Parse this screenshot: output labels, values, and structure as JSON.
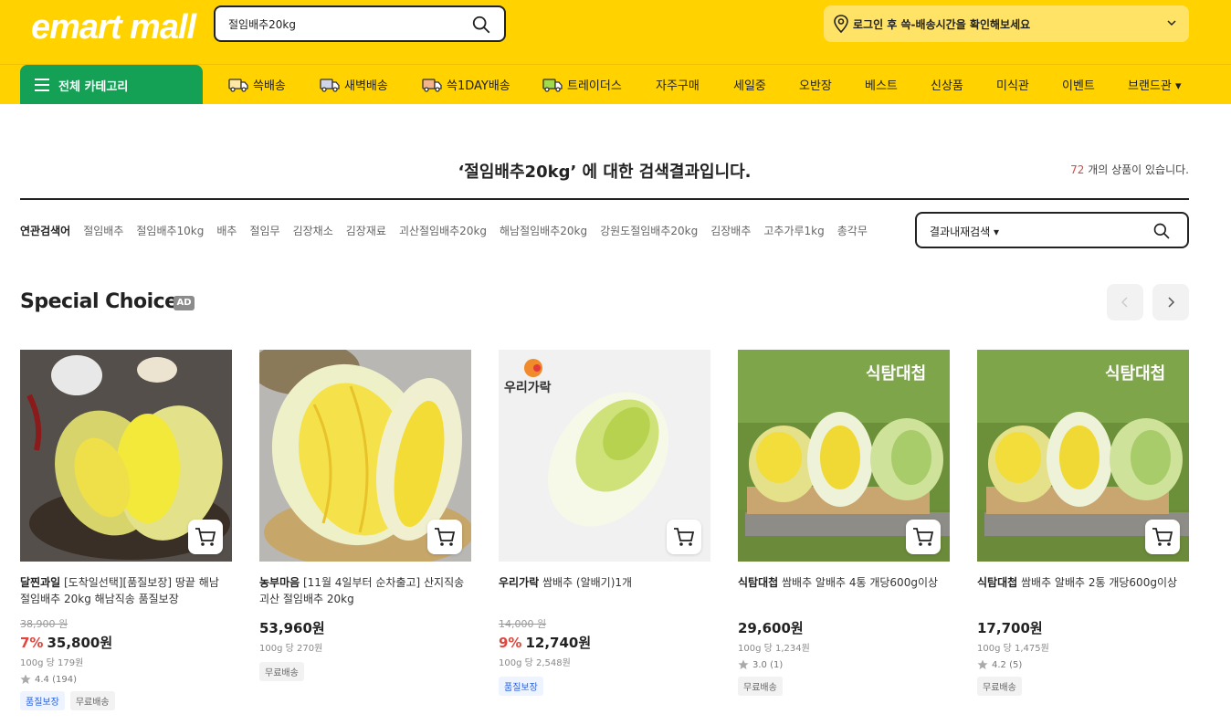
{
  "header": {
    "logo": "emart mall",
    "search_value": "절임배추20kg",
    "delivery_text": "로그인 후 쓱-배송시간을 확인해보세요",
    "all_category": "전체 카테고리",
    "nav": [
      {
        "label": "쓱배송",
        "icon": "truck-icon",
        "color": "#ffe7a6"
      },
      {
        "label": "새벽배송",
        "icon": "truck-icon",
        "color": "#cfd6ea"
      },
      {
        "label": "쓱1DAY배송",
        "icon": "truck-icon",
        "color": "#f2b48a"
      },
      {
        "label": "트레이더스",
        "icon": "truck-icon",
        "color": "#a3d94c"
      },
      {
        "label": "자주구매"
      },
      {
        "label": "세일중"
      },
      {
        "label": "오반장"
      },
      {
        "label": "베스트"
      },
      {
        "label": "신상품"
      },
      {
        "label": "미식관"
      },
      {
        "label": "이벤트"
      },
      {
        "label": "브랜드관 ▾"
      }
    ]
  },
  "result": {
    "title": "‘절임배추20kg’ 에 대한 검색결과입니다.",
    "count": "72",
    "count_suffix": " 개의 상품이 있습니다."
  },
  "related": {
    "head": "연관검색어",
    "keywords": [
      "절임배추",
      "절임배추10kg",
      "배추",
      "절임무",
      "김장채소",
      "김장재료",
      "괴산절임배추20kg",
      "해남절임배추20kg",
      "강원도절임배추20kg",
      "김장배추",
      "고추가루1kg",
      "총각무"
    ]
  },
  "inner_search": {
    "label": "결과내재검색 ▾"
  },
  "special": {
    "title": "Special Choice",
    "ad": "AD"
  },
  "products": [
    {
      "brand": "달찐과일",
      "name": " [도착일선택][품질보장] 땅끝 해남 절임배추 20kg 해남직송 품질보장",
      "orig": "38,900 원",
      "disc": "7%",
      "price": "35,800원",
      "unit": "100g 당 179원",
      "rating": "4.4 (194)",
      "tags": [
        {
          "t": "품질보장",
          "blue": true
        },
        {
          "t": "무료배송",
          "blue": false
        }
      ]
    },
    {
      "brand": "농부마음",
      "name": " [11월 4일부터 순차출고] 산지직송 괴산 절임배추 20kg",
      "orig": "",
      "disc": "",
      "price": "53,960원",
      "unit": "100g 당 270원",
      "rating": "",
      "tags": [
        {
          "t": "무료배송",
          "blue": false
        }
      ]
    },
    {
      "brand": "우리가락",
      "name": " 쌈배추 (알배기)1개",
      "orig": "14,000 원",
      "disc": "9%",
      "price": "12,740원",
      "unit": "100g 당 2,548원",
      "rating": "",
      "tags": [
        {
          "t": "품질보장",
          "blue": true
        }
      ],
      "image_label": "우리가락"
    },
    {
      "brand": "식탐대첩",
      "name": " 쌈배추 알배추 4통 개당600g이상",
      "orig": "",
      "disc": "",
      "price": "29,600원",
      "unit": "100g 당 1,234원",
      "rating": "3.0 (1)",
      "tags": [
        {
          "t": "무료배송",
          "blue": false
        }
      ],
      "image_label": "식탐대첩"
    },
    {
      "brand": "식탐대첩",
      "name": " 쌈배추 알배추 2통 개당600g이상",
      "orig": "",
      "disc": "",
      "price": "17,700원",
      "unit": "100g 당 1,475원",
      "rating": "4.2 (5)",
      "tags": [
        {
          "t": "무료배송",
          "blue": false
        }
      ],
      "image_label": "식탐대첩"
    }
  ]
}
